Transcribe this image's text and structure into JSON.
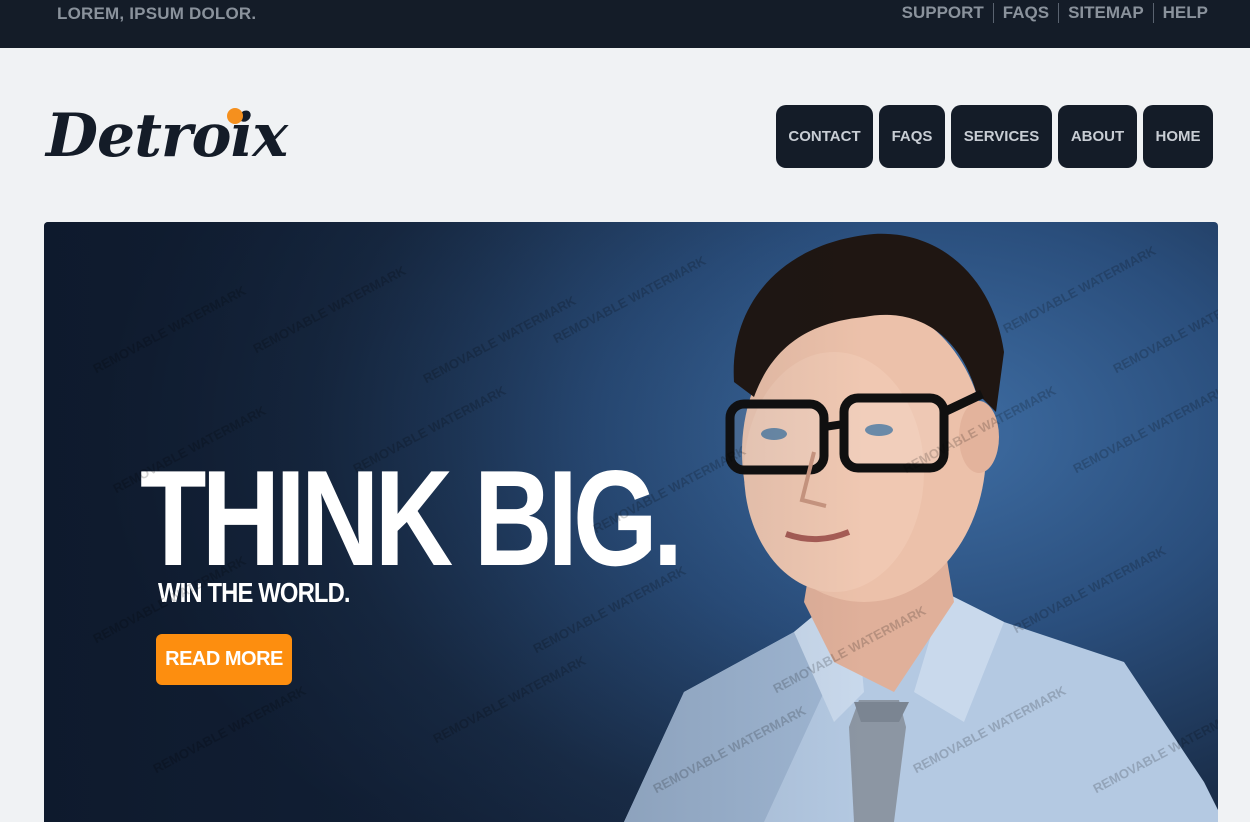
{
  "topbar": {
    "tagline": "LOREM, IPSUM DOLOR.",
    "links": [
      "SUPPORT",
      "FAQS",
      "SITEMAP",
      "HELP"
    ]
  },
  "logo": {
    "text": "Detroix"
  },
  "nav": {
    "items": [
      "CONTACT",
      "FAQS",
      "SERVICES",
      "ABOUT",
      "HOME"
    ]
  },
  "hero": {
    "headline": "THINK BIG.",
    "subline": "WIN THE WORLD.",
    "button": "READ MORE",
    "watermark": "REMOVABLE WATERMARK"
  },
  "colors": {
    "dark": "#141c28",
    "accent": "#fd8e0f",
    "background": "#f0f2f4"
  }
}
